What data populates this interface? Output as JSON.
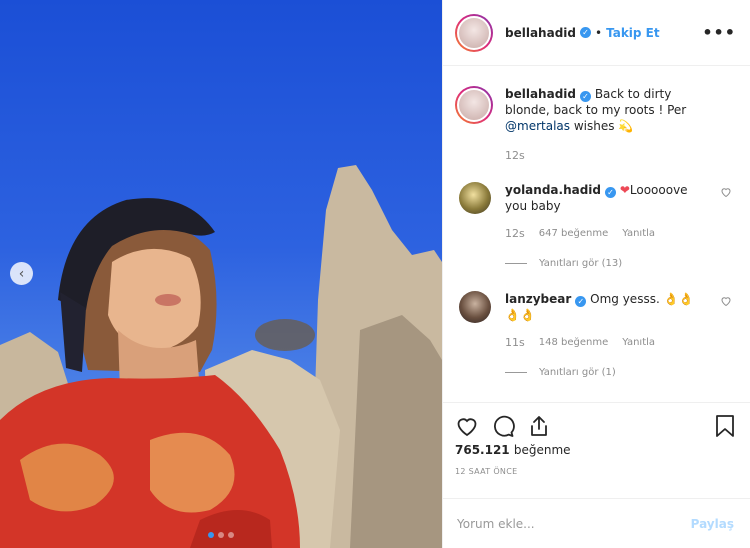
{
  "header": {
    "username": "bellahadid",
    "separator": "•",
    "follow_label": "Takip Et",
    "more_label": "•••"
  },
  "caption": {
    "username": "bellahadid",
    "text_1": "Back to dirty blonde, back to my roots ! Per",
    "mention": "@mertalas",
    "text_2": "wishes",
    "emoji": "💫",
    "time": "12s"
  },
  "comments": [
    {
      "username": "yolanda.hadid",
      "text": "Looooove you baby",
      "emoji": "❤",
      "time": "12s",
      "likes": "647 beğenme",
      "reply_label": "Yanıtla",
      "view_replies": "Yanıtları gör (13)"
    },
    {
      "username": "lanzybear",
      "text": "Omg yesss.",
      "emoji": "👌👌👌👌",
      "time": "11s",
      "likes": "148 beğenme",
      "reply_label": "Yanıtla",
      "view_replies": "Yanıtları gör (1)"
    }
  ],
  "actions": {
    "like_count": "765.121",
    "like_label": "beğenme",
    "ago": "12 SAAT ÖNCE"
  },
  "add_comment": {
    "placeholder": "Yorum ekle...",
    "post_label": "Paylaş"
  },
  "colors": {
    "accent": "#3897f0",
    "sky": "#2d62e0",
    "heart": "#ed4956",
    "post_disabled": "#b3dbff"
  },
  "icons": [
    "verified-icon",
    "more-icon",
    "heart-icon",
    "comment-icon",
    "share-icon",
    "bookmark-icon",
    "chevron-left-icon"
  ]
}
